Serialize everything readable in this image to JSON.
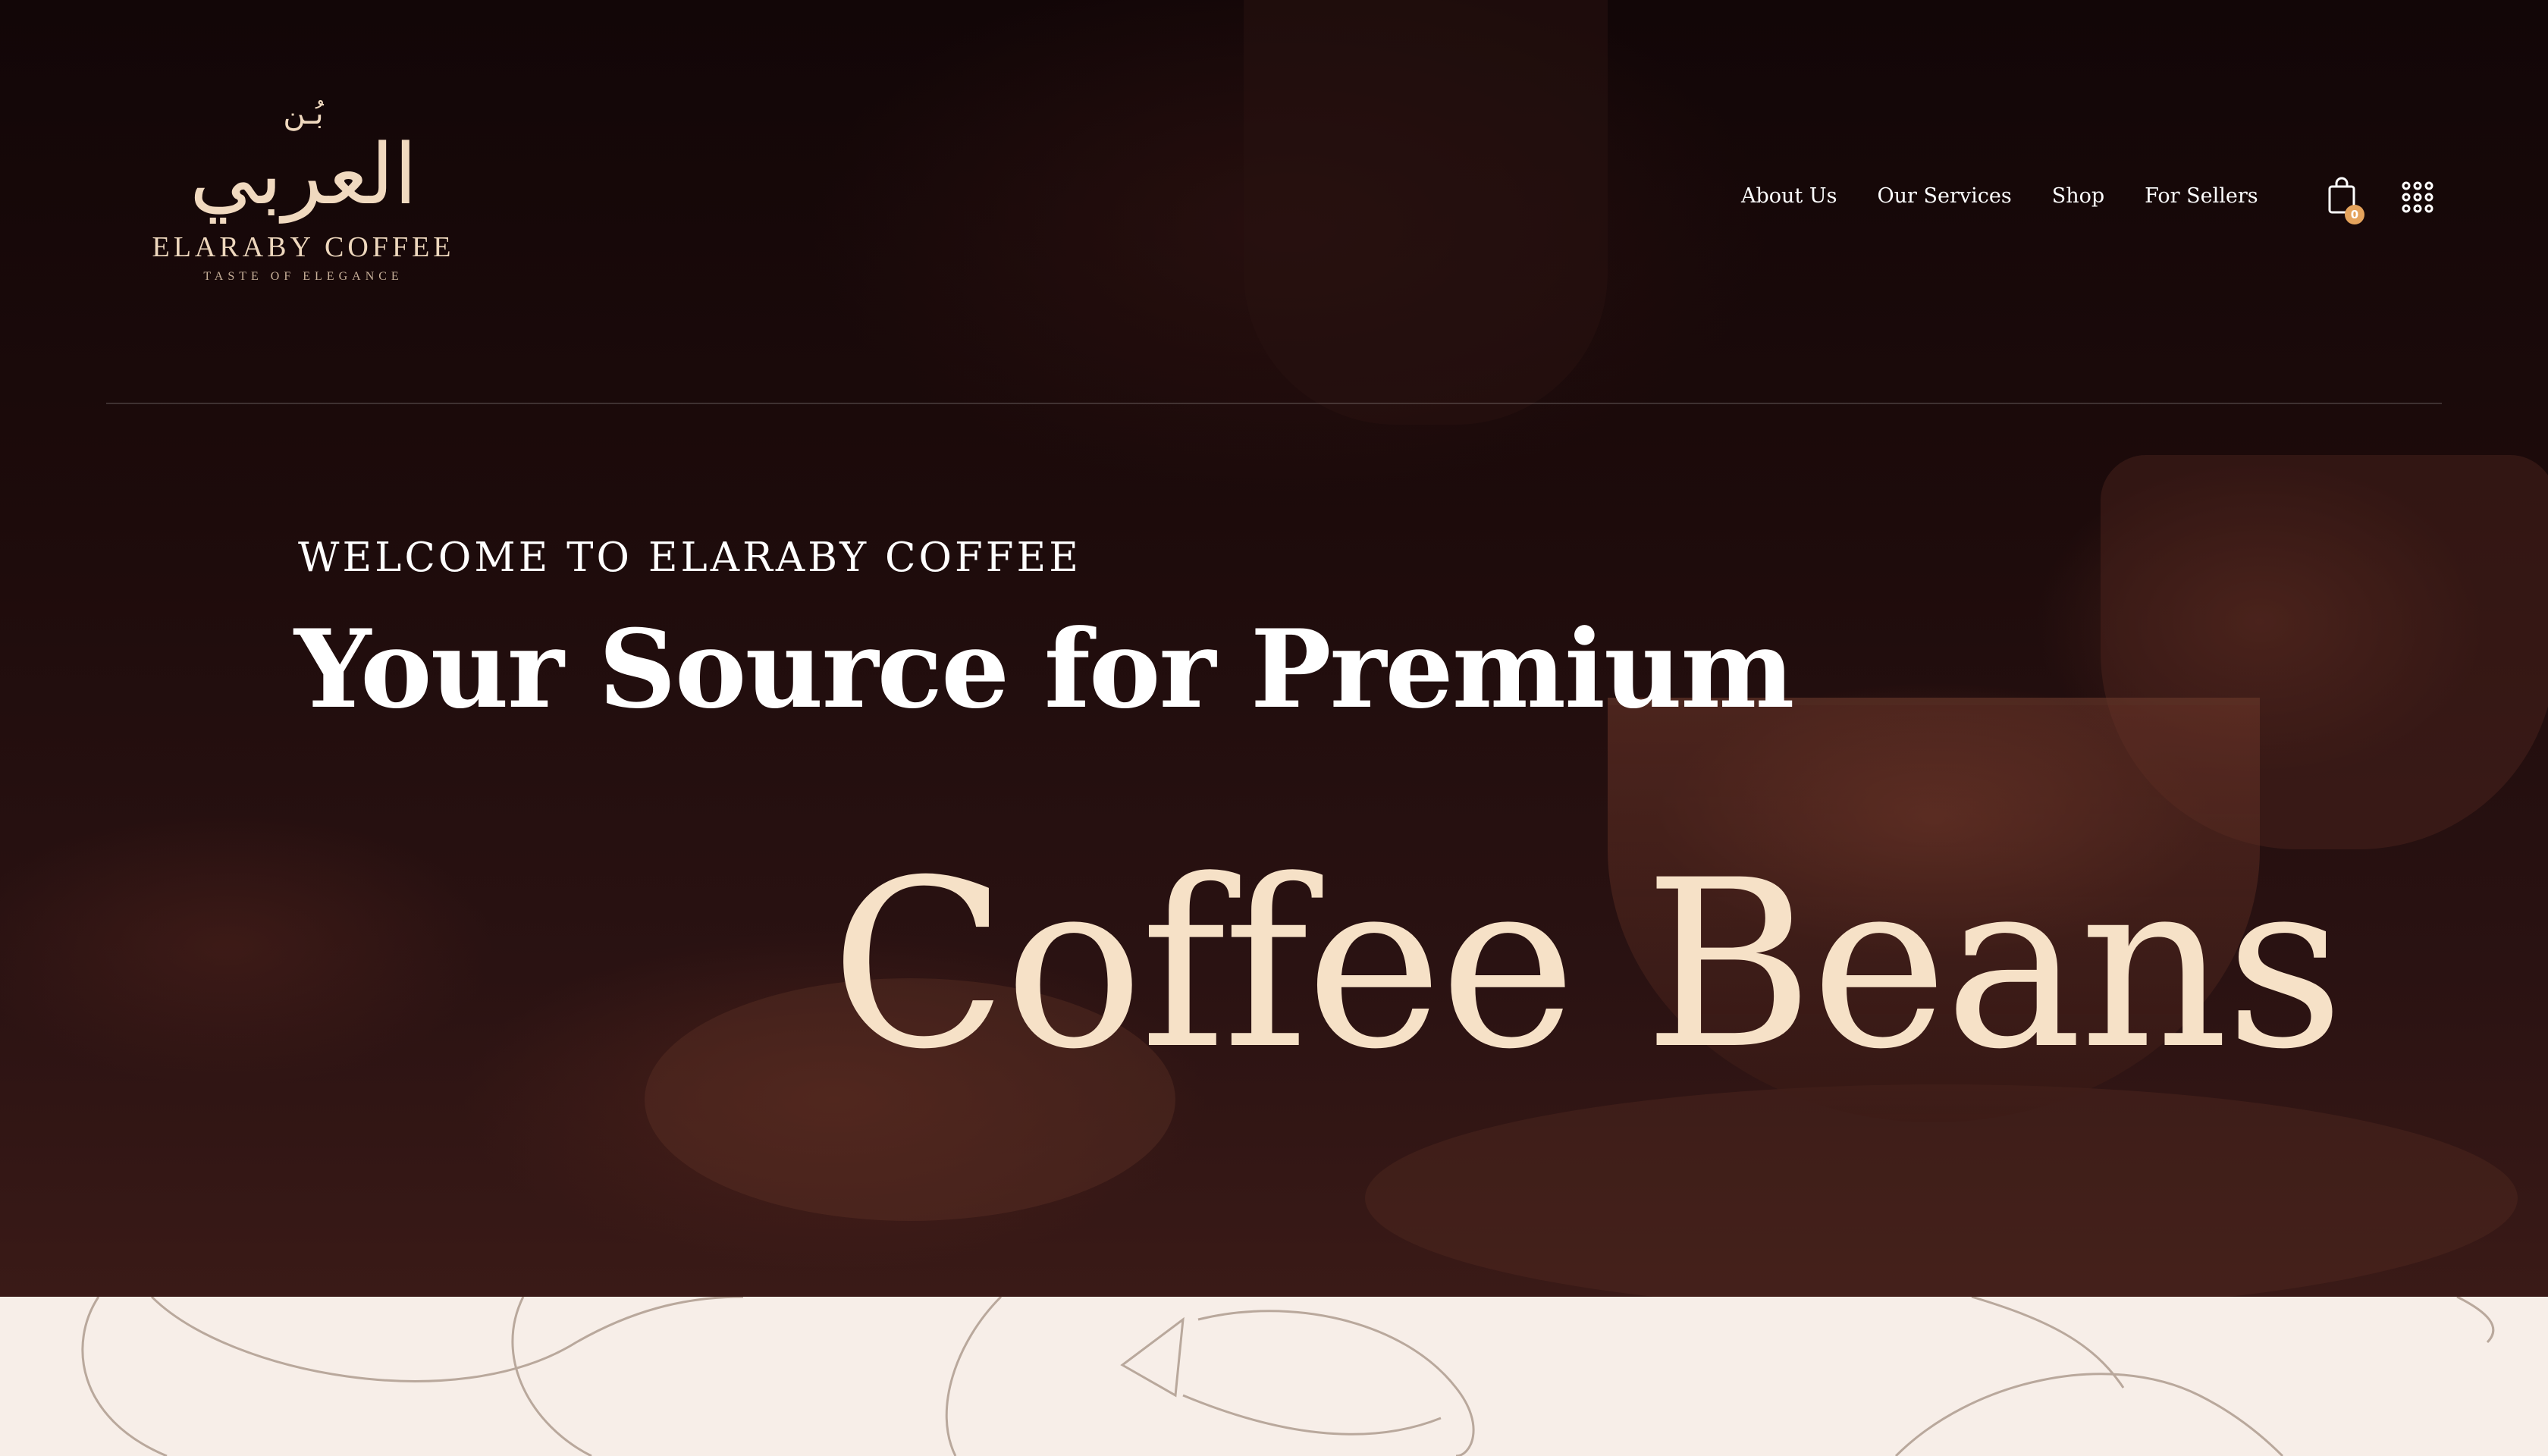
{
  "header": {
    "logo": {
      "arabic_mark": "العربي",
      "arabic_prefix": "بُـن",
      "brand": "ELARABY COFFEE",
      "tagline": "TASTE OF ELEGANCE"
    },
    "nav": [
      {
        "label": "About Us"
      },
      {
        "label": "Our Services"
      },
      {
        "label": "Shop"
      },
      {
        "label": "For Sellers"
      }
    ],
    "cart": {
      "icon": "shopping-bag-icon",
      "count": "0"
    },
    "menu": {
      "icon": "grid-dots-icon"
    }
  },
  "hero": {
    "welcome": "WELCOME TO ELARABY COFFEE",
    "headline": "Your Source for Premium",
    "highlight": "Coffee Beans"
  },
  "colors": {
    "accent": "#e5a35c",
    "highlight_text": "#f6e1c7",
    "hero_bg": "#1d0b0b",
    "section_bg": "#f7eee8"
  }
}
